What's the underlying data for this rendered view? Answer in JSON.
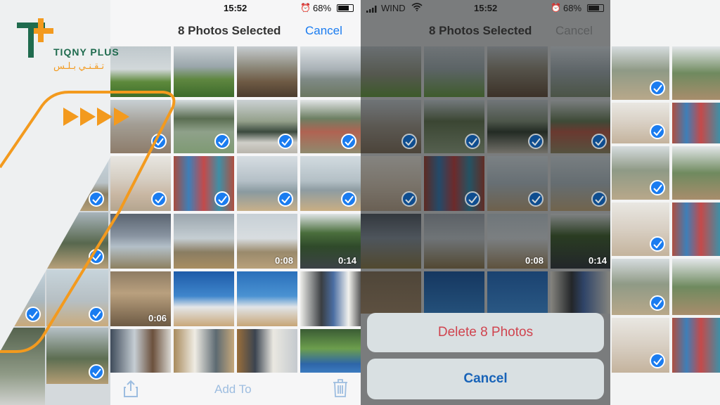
{
  "brand": {
    "name": "TIQNY PLUS",
    "arabic": "تـقـنـي بـلـس"
  },
  "left_screen": {
    "title": "8 Photos Selected",
    "cancel_label": "Cancel",
    "time": "15:52",
    "battery": "68%",
    "toolbar": {
      "add_to_label": "Add To",
      "share_icon": "share-icon",
      "trash_icon": "trash-icon"
    },
    "durations": [
      "0:08",
      "0:14",
      "0:06"
    ]
  },
  "right_screen": {
    "carrier": "WIND",
    "time": "15:52",
    "battery": "68%",
    "title": "8 Photos Selected",
    "cancel_label": "Cancel",
    "durations": [
      "0:08",
      "0:14"
    ],
    "action_sheet": {
      "delete_label": "Delete 8 Photos",
      "cancel_label": "Cancel"
    }
  },
  "colors": {
    "accent": "#1a7cf0",
    "brand_orange": "#f39a1e",
    "brand_green": "#1f6b4e",
    "destructive": "#d0444f"
  }
}
